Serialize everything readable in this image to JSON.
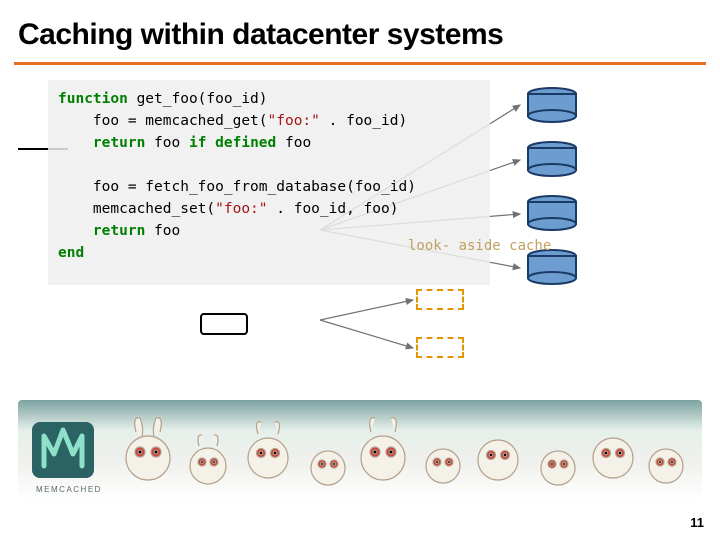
{
  "title": "Caching within datacenter systems",
  "code": {
    "l1_kw": "function",
    "l1_fn": " get_foo(foo_id)",
    "l2": "    foo = memcached_get(",
    "l2_str": "\"foo:\"",
    "l2_tail": " . foo_id)",
    "l3_kw": "    return",
    "l3_tail": " foo ",
    "l3_kw2": "if defined",
    "l3_tail2": " foo",
    "l4": "",
    "l5": "    foo = fetch_foo_from_database(foo_id)",
    "l6": "    memcached_set(",
    "l6_str": "\"foo:\"",
    "l6_tail": " . foo_id, foo)",
    "l7_kw": "    return",
    "l7_tail": " foo",
    "l8_kw": "end"
  },
  "label": "look-\naside\ncache",
  "page": "11",
  "footer_logo": "MEMCACHED"
}
